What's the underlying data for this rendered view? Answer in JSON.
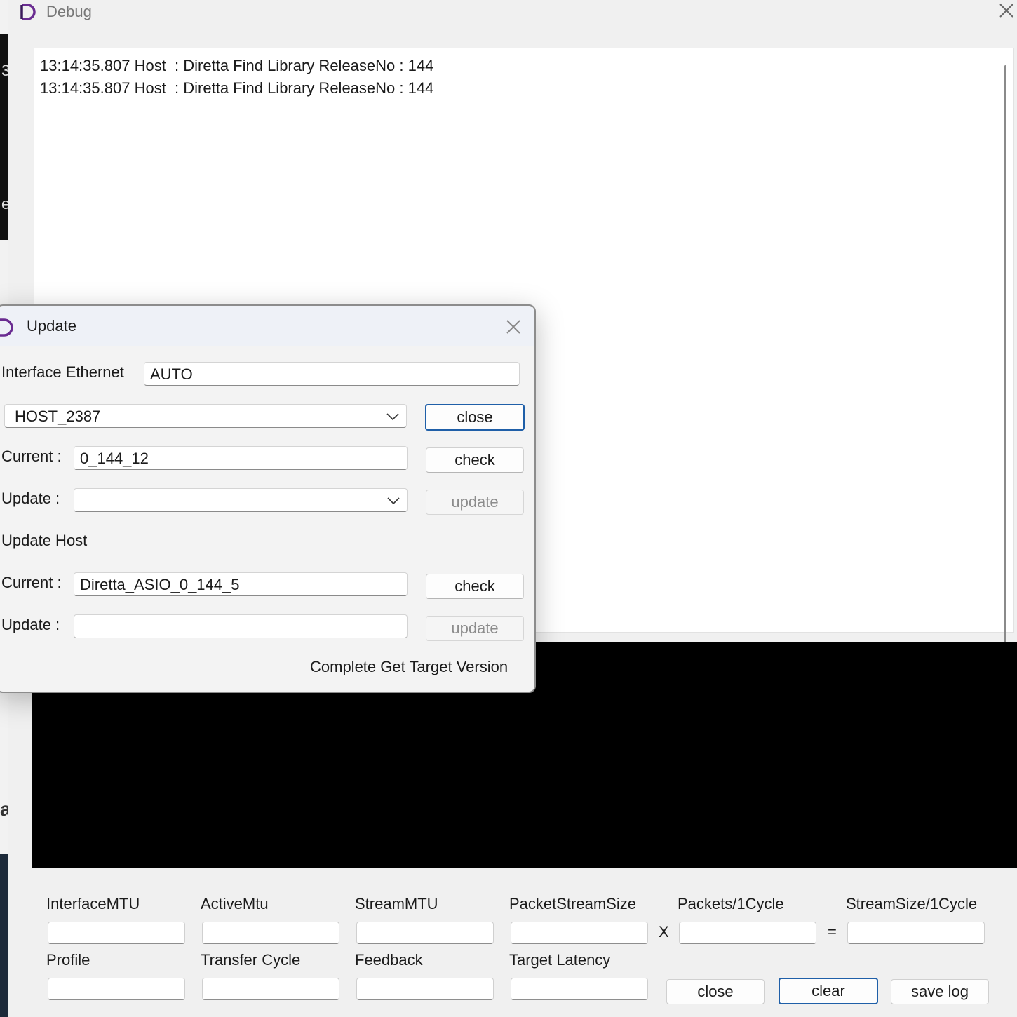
{
  "background": {
    "glyphs": [
      "3",
      "e",
      "a"
    ]
  },
  "debug_window": {
    "title": "Debug",
    "close_icon": "close-icon",
    "log_lines": [
      "13:14:35.807 Host  : Diretta Find Library ReleaseNo : 144",
      "13:14:35.807 Host  : Diretta Find Library ReleaseNo : 144"
    ],
    "stats_row1": {
      "interface_mtu": {
        "label": "InterfaceMTU",
        "value": ""
      },
      "active_mtu": {
        "label": "ActiveMtu",
        "value": ""
      },
      "stream_mtu": {
        "label": "StreamMTU",
        "value": ""
      },
      "packet_stream_size": {
        "label": "PacketStreamSize",
        "value": ""
      },
      "multiply_sign": "X",
      "packets_per_cycle": {
        "label": "Packets/1Cycle",
        "value": ""
      },
      "equals_sign": "=",
      "stream_size_per_cycle": {
        "label": "StreamSize/1Cycle",
        "value": ""
      }
    },
    "stats_row2": {
      "profile": {
        "label": "Profile",
        "value": ""
      },
      "transfer_cycle": {
        "label": "Transfer Cycle",
        "value": ""
      },
      "feedback": {
        "label": "Feedback",
        "value": ""
      },
      "target_latency": {
        "label": "Target Latency",
        "value": ""
      }
    },
    "buttons": {
      "close": "close",
      "clear": "clear",
      "save_log": "save log"
    }
  },
  "update_dialog": {
    "title": "Update",
    "interface_label": "Interface Ethernet",
    "interface_value": "AUTO",
    "host_select": "HOST_2387",
    "close_button": "close",
    "target": {
      "current_label": "Current :",
      "current_value": "0_144_12",
      "check_button": "check",
      "update_label": "Update :",
      "update_select": "",
      "update_button": "update"
    },
    "host_section_label": "Update Host",
    "host": {
      "current_label": "Current :",
      "current_value": "Diretta_ASIO_0_144_5",
      "check_button": "check",
      "update_label": "Update :",
      "update_value": "",
      "update_button": "update"
    },
    "status_text": "Complete Get Target Version"
  },
  "colors": {
    "accent_focus": "#1f5fa8",
    "app_icon_purple": "#6a2c91"
  }
}
